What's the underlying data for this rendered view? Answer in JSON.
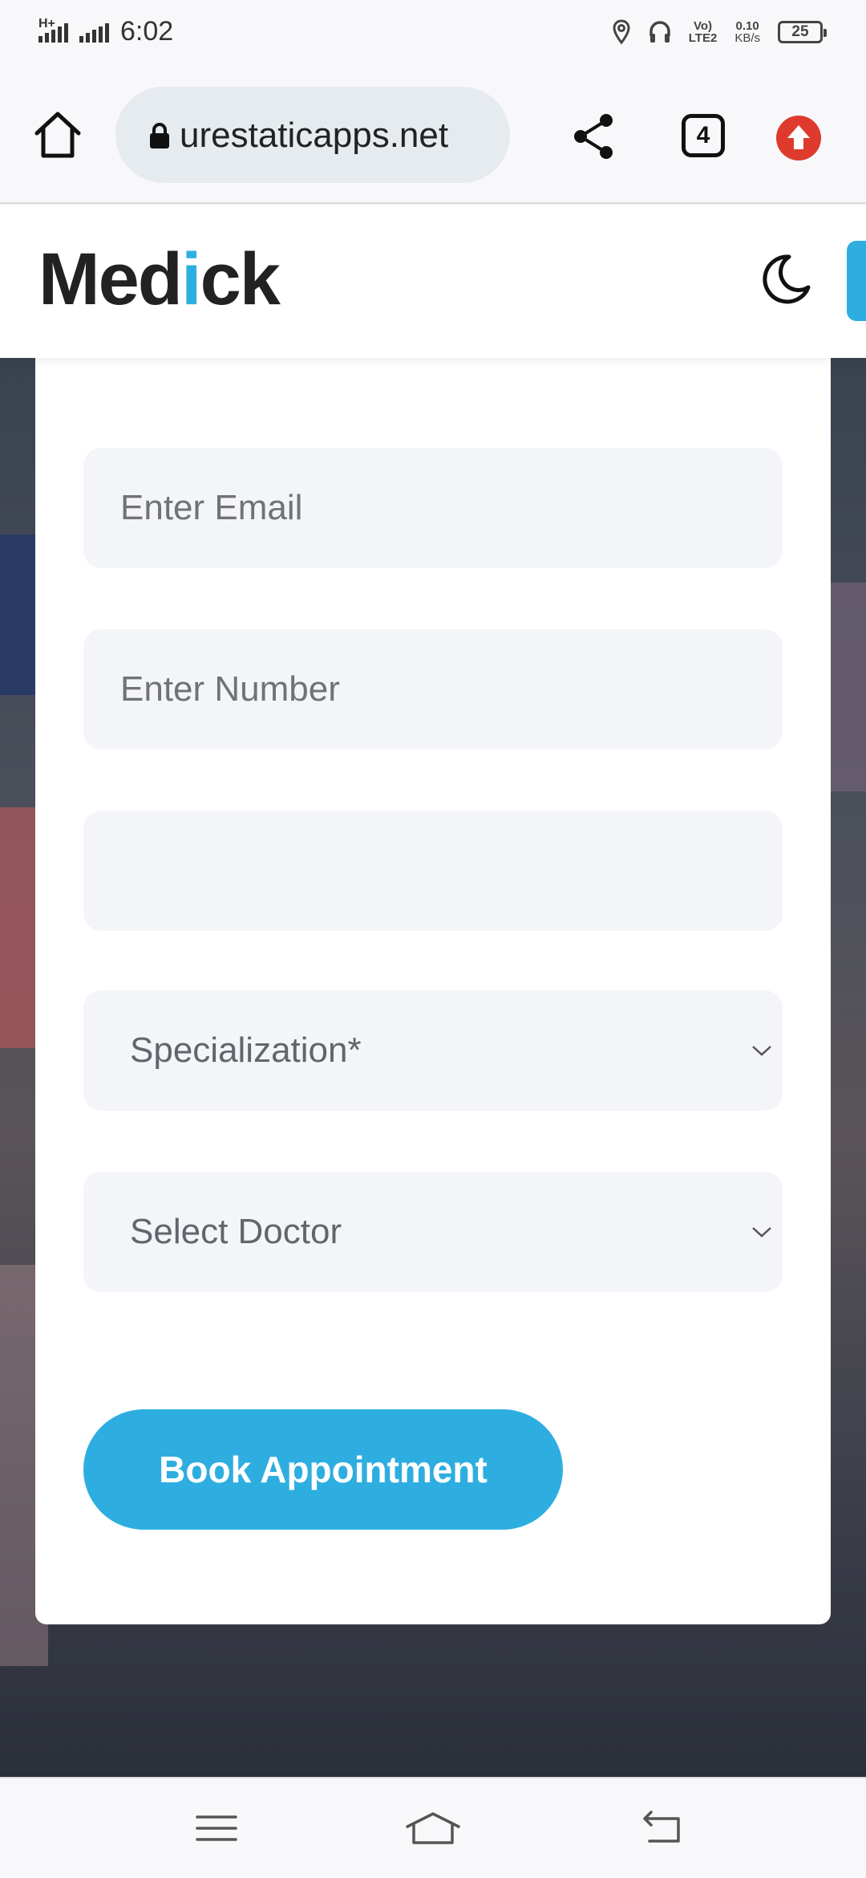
{
  "status_bar": {
    "network": "H+",
    "time": "6:02",
    "volte": "Vo)",
    "lte": "LTE2",
    "speed_value": "0.10",
    "speed_unit": "KB/s",
    "battery": "25"
  },
  "browser": {
    "url": "urestaticapps.net",
    "tab_count": "4"
  },
  "site": {
    "logo_prefix": "Med",
    "logo_accent": "i",
    "logo_suffix": "ck",
    "accent_color": "#2eaee0"
  },
  "form": {
    "email_placeholder": "Enter Email",
    "number_placeholder": "Enter Number",
    "blank_field_placeholder": "",
    "specialization_selected": "Specialization*",
    "doctor_selected": "Select Doctor",
    "submit_label": "Book Appointment"
  }
}
